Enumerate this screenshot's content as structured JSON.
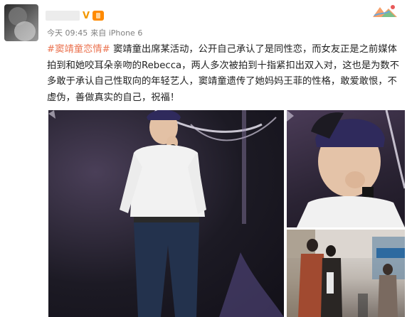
{
  "post": {
    "verified_mark": "V",
    "meta": {
      "time": "今天 09:45",
      "source": "来自 iPhone 6"
    },
    "hashtag": "#窦靖童恋情#",
    "text": " 窦靖童出席某活动，公开自己承认了是同性恋，而女友正是之前媒体拍到和她咬耳朵亲吻的Rebecca，两人多次被拍到十指紧扣出双入对，这也是为数不多敢于承认自己性取向的年轻艺人，窦靖童遗传了她妈妈王菲的性格，敢爱敢恨，不虚伪，善做真实的自己，祝福！"
  },
  "colors": {
    "hashtag": "#eb7350",
    "verified": "#f39800",
    "meta_text": "#808080"
  }
}
